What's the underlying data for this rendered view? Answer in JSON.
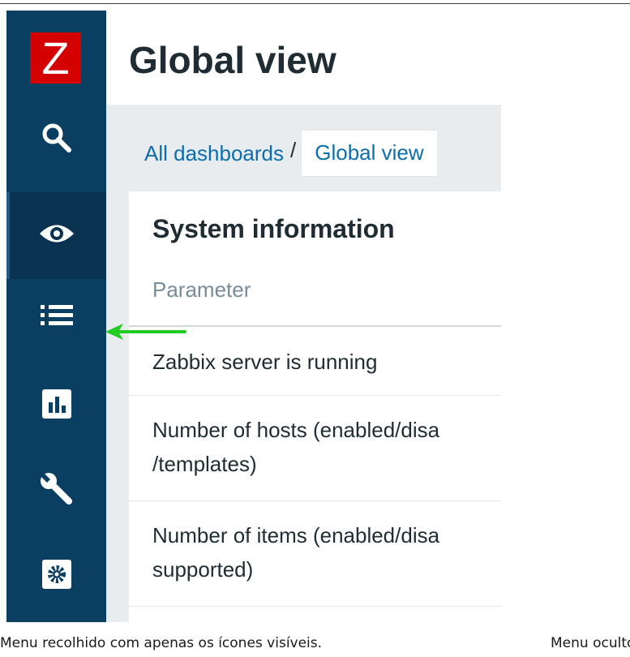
{
  "app": {
    "logo_letter": "Z",
    "brand_color": "#d40000",
    "sidebar_color": "#0b3f61"
  },
  "sidebar": {
    "icons": [
      "search-icon",
      "eye-icon",
      "list-icon",
      "bar-chart-icon",
      "wrench-icon",
      "gear-icon"
    ],
    "active_item": "eye-icon"
  },
  "header": {
    "title": "Global view"
  },
  "breadcrumb": {
    "parent": "All dashboards",
    "separator": "/",
    "current": "Global view"
  },
  "widget": {
    "title": "System information",
    "column_header": "Parameter",
    "rows": [
      {
        "lines": [
          "Zabbix server is running"
        ]
      },
      {
        "lines": [
          "Number of hosts (enabled/disa",
          "/templates)"
        ]
      },
      {
        "lines": [
          "Number of items (enabled/disa",
          "supported)"
        ]
      }
    ]
  },
  "annotation": {
    "arrow_color": "#22cc22",
    "arrow_target": "list-icon"
  },
  "captions": {
    "left": "Menu recolhido com apenas os ícones visíveis.",
    "right": "Menu oculto"
  }
}
